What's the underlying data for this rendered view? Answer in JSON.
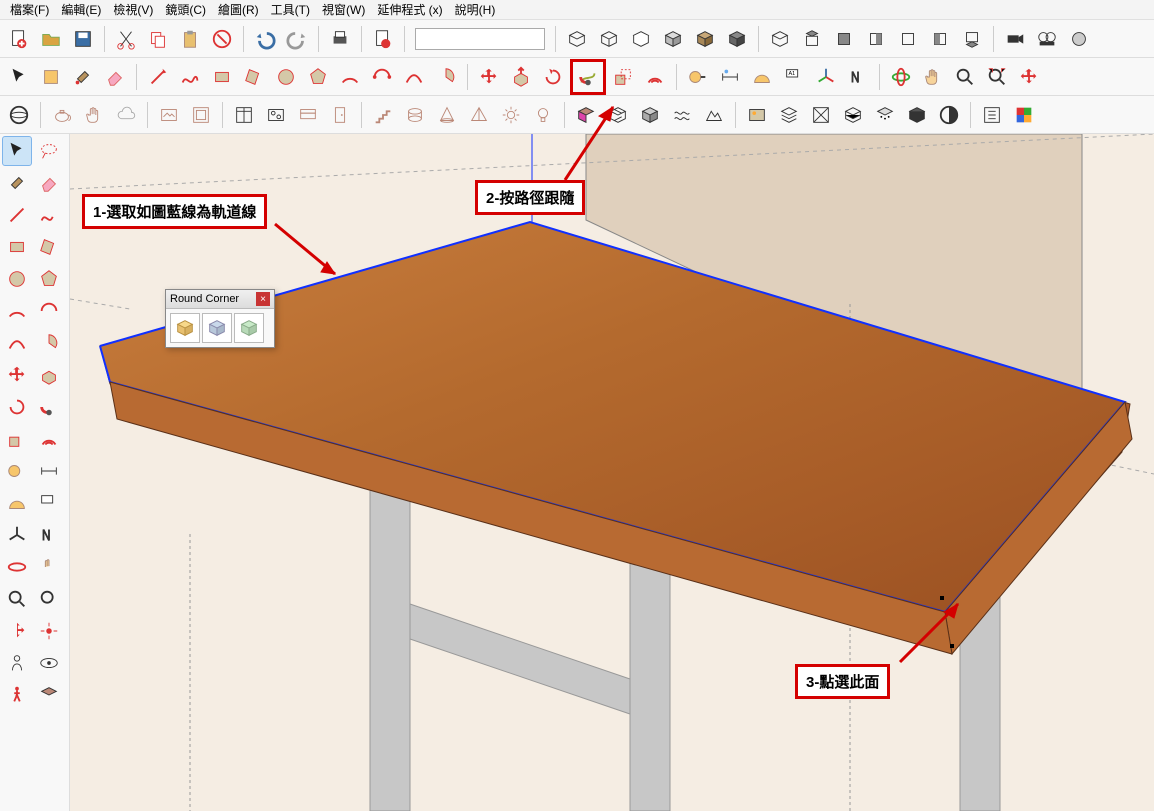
{
  "menu": {
    "file": "檔案(F)",
    "edit": "編輯(E)",
    "view": "檢視(V)",
    "camera": "鏡頭(C)",
    "draw": "繪圖(R)",
    "tools": "工具(T)",
    "window": "視窗(W)",
    "extensions": "延伸程式 (x)",
    "help": "說明(H)"
  },
  "callouts": {
    "c1": "1-選取如圖藍線為軌道線",
    "c2": "2-按路徑跟隨",
    "c3": "3-點選此面"
  },
  "panel": {
    "title": "Round Corner"
  },
  "colors": {
    "accent_red": "#d40000",
    "bg_cream": "#f5ede3",
    "wood_top": "#b46a2e",
    "wood_side": "#a8592a"
  }
}
